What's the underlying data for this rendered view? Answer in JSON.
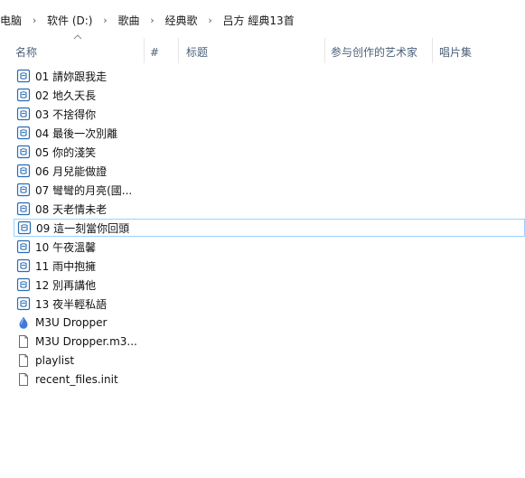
{
  "breadcrumb": {
    "items": [
      "电脑",
      "软件 (D:)",
      "歌曲",
      "经典歌",
      "吕方 經典13首"
    ],
    "separator": "›"
  },
  "columns": {
    "name": "名称",
    "number": "#",
    "title": "标题",
    "contributing_artists": "参与创作的艺术家",
    "album": "唱片集"
  },
  "files": [
    {
      "name": "01 請妳跟我走",
      "icon": "audio-file-icon"
    },
    {
      "name": "02 地久天長",
      "icon": "audio-file-icon"
    },
    {
      "name": "03 不捨得你",
      "icon": "audio-file-icon"
    },
    {
      "name": "04 最後一次別離",
      "icon": "audio-file-icon"
    },
    {
      "name": "05 你的淺笑",
      "icon": "audio-file-icon"
    },
    {
      "name": "06 月兒能做證",
      "icon": "audio-file-icon"
    },
    {
      "name": "07 彎彎的月亮(國...",
      "icon": "audio-file-icon"
    },
    {
      "name": "08 天老情未老",
      "icon": "audio-file-icon"
    },
    {
      "name": "09 這一刻當你回頭",
      "icon": "audio-file-icon",
      "selected": true
    },
    {
      "name": "10 午夜溫馨",
      "icon": "audio-file-icon"
    },
    {
      "name": "11 雨中抱擁",
      "icon": "audio-file-icon"
    },
    {
      "name": "12 別再講他",
      "icon": "audio-file-icon"
    },
    {
      "name": "13 夜半輕私語",
      "icon": "audio-file-icon"
    },
    {
      "name": "M3U Dropper",
      "icon": "app-drop-icon"
    },
    {
      "name": "M3U Dropper.m3...",
      "icon": "document-file-icon"
    },
    {
      "name": "playlist",
      "icon": "document-file-icon"
    },
    {
      "name": "recent_files.init",
      "icon": "document-file-icon"
    }
  ],
  "colors": {
    "header_text": "#4c607a",
    "selection_border": "#99d1ff",
    "audio_icon": "#2b6cb3",
    "drop_icon": "#3f7ad9"
  }
}
